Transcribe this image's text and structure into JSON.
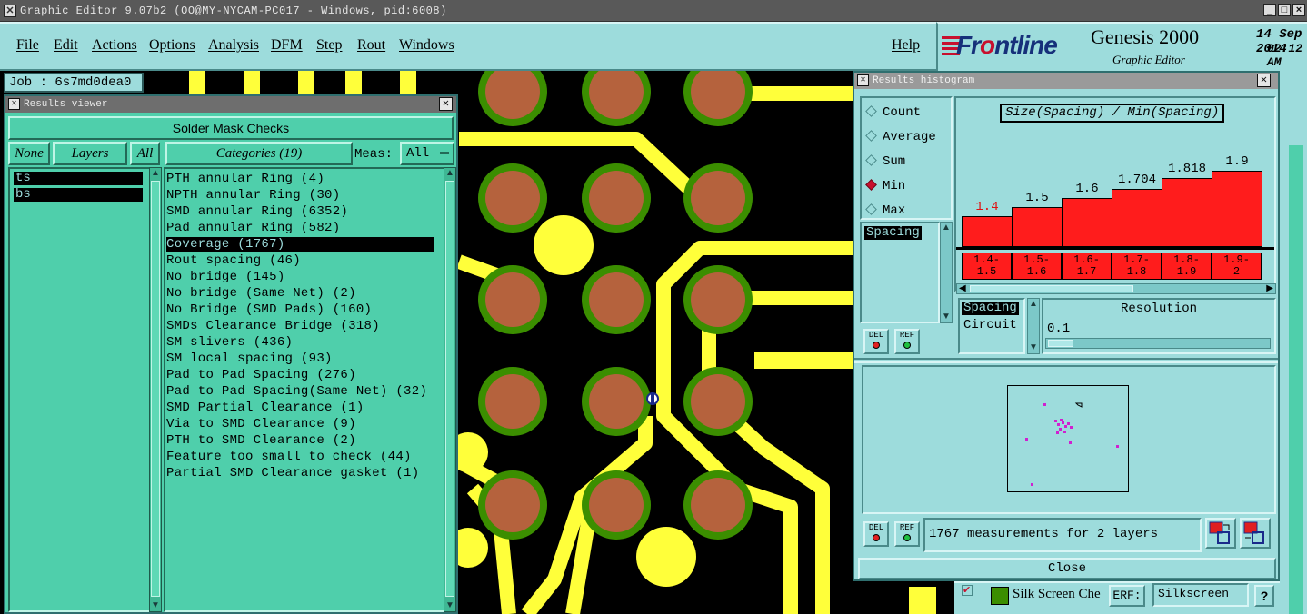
{
  "titlebar": {
    "text": "Graphic Editor 9.07b2 (OO@MY-NYCAM-PC017 - Windows, pid:6008)",
    "min": "_",
    "max": "□",
    "close": "×"
  },
  "menu": {
    "items": [
      "File",
      "Edit",
      "Actions",
      "Options",
      "Analysis",
      "DFM",
      "Step",
      "Rout",
      "Windows"
    ],
    "help": "Help"
  },
  "brand": {
    "logo_pre": "Fr",
    "logo_o": "o",
    "logo_post": "ntline",
    "product": "Genesis 2000",
    "subtitle": "Graphic Editor",
    "date": "14 Sep 2014",
    "time": "02:12 AM"
  },
  "job": {
    "label": "Job : 6s7md0dea0"
  },
  "results_viewer": {
    "title": "Results viewer",
    "header": "Solder Mask Checks",
    "none_btn": "None",
    "layers_btn": "Layers",
    "all_btn": "All",
    "categories_btn": "Categories (19)",
    "meas_label": "Meas:",
    "meas_value": "All",
    "layers": [
      "ts",
      "bs"
    ],
    "categories": [
      "PTH annular Ring (4)",
      "NPTH annular Ring (30)",
      "SMD annular Ring (6352)",
      "Pad annular Ring (582)",
      "Coverage (1767)",
      "Rout spacing (46)",
      "No bridge (145)",
      "No bridge (Same Net) (2)",
      "No Bridge (SMD Pads) (160)",
      "SMDs Clearance Bridge (318)",
      "SM slivers (436)",
      "SM local spacing (93)",
      "Pad to Pad Spacing (276)",
      "Pad to Pad Spacing(Same Net) (32)",
      "SMD Partial Clearance (1)",
      "Via to SMD Clearance (9)",
      "PTH to SMD Clearance (2)",
      "Feature too small to check (44)",
      "Partial SMD Clearance gasket (1)"
    ],
    "selected_index": 4
  },
  "histogram": {
    "title": "Results histogram",
    "modes": [
      "Count",
      "Average",
      "Sum",
      "Min",
      "Max"
    ],
    "selected_mode": "Min",
    "chart_title": "Size(Spacing) / Min(Spacing)",
    "values": [
      "1.4",
      "1.5",
      "1.6",
      "1.704",
      "1.818",
      "1.9"
    ],
    "bars": [
      1.4,
      1.5,
      1.6,
      1.704,
      1.818,
      1.9
    ],
    "bins": [
      [
        "1.4-",
        "1.5"
      ],
      [
        "1.5-",
        "1.6"
      ],
      [
        "1.6-",
        "1.7"
      ],
      [
        "1.7-",
        "1.8"
      ],
      [
        "1.8-",
        "1.9"
      ],
      [
        "1.9-",
        "2"
      ]
    ],
    "list_item": "Spacing",
    "measure_list": [
      "Spacing",
      "Circuit"
    ],
    "resolution_label": "Resolution",
    "resolution_value": "0.1",
    "del": "DEL",
    "ref": "REF",
    "status": "1767 measurements for 2 layers",
    "close": "Close"
  },
  "bottom_strip": {
    "label": "Silk Screen Che",
    "erf": "ERF:",
    "erf_value": "Silkscreen",
    "help": "?"
  },
  "colors": {
    "teal": "#4fcfab",
    "cyan": "#9ddcdc",
    "trace": "#ffff3a",
    "pad": "#b5623d",
    "ring": "#3b8e00",
    "bar": "#ff1c1c"
  }
}
